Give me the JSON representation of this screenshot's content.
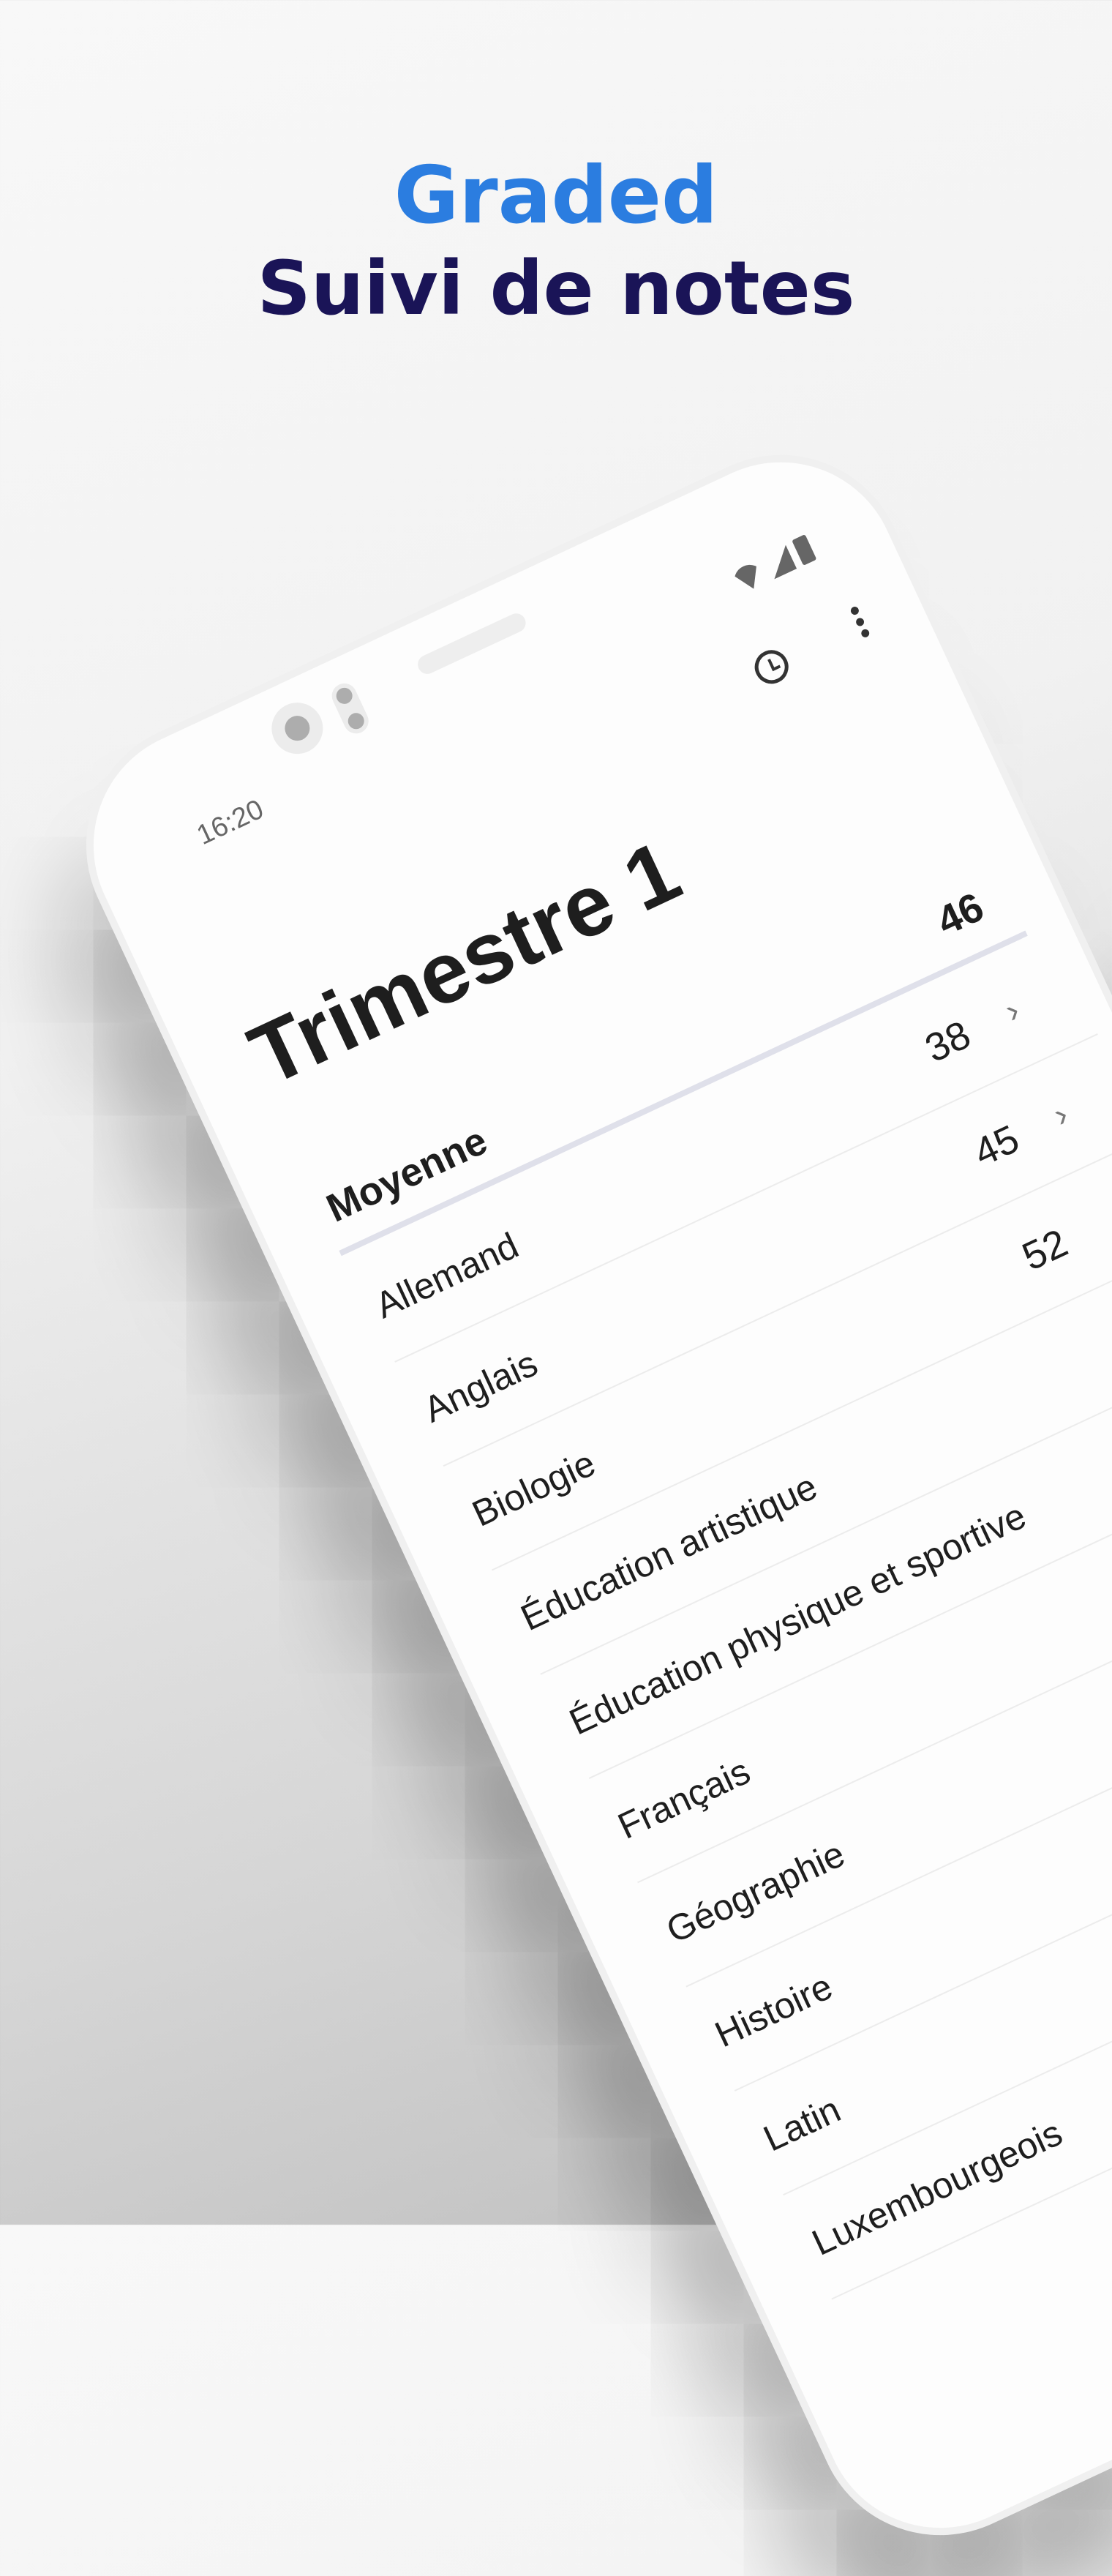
{
  "hero": {
    "app_name": "Graded",
    "tagline": "Suivi de notes"
  },
  "colors": {
    "app_name": "#2b7de0",
    "tagline": "#1a1457"
  },
  "status_bar": {
    "time": "16:20",
    "icons": [
      "wifi-icon",
      "signal-icon",
      "battery-icon"
    ]
  },
  "toolbar": {
    "icons": [
      "history-clock-icon",
      "more-vert-icon"
    ]
  },
  "page": {
    "title": "Trimestre 1",
    "average_label": "Moyenne",
    "average_value": "46"
  },
  "subjects": [
    {
      "name": "Allemand",
      "grade": "38",
      "chevron": "›"
    },
    {
      "name": "Anglais",
      "grade": "45",
      "chevron": "›"
    },
    {
      "name": "Biologie",
      "grade": "52"
    },
    {
      "name": "Éducation artistique"
    },
    {
      "name": "Éducation physique et sportive"
    },
    {
      "name": "Français"
    },
    {
      "name": "Géographie"
    },
    {
      "name": "Histoire"
    },
    {
      "name": "Latin"
    },
    {
      "name": "Luxembourgeois"
    }
  ]
}
